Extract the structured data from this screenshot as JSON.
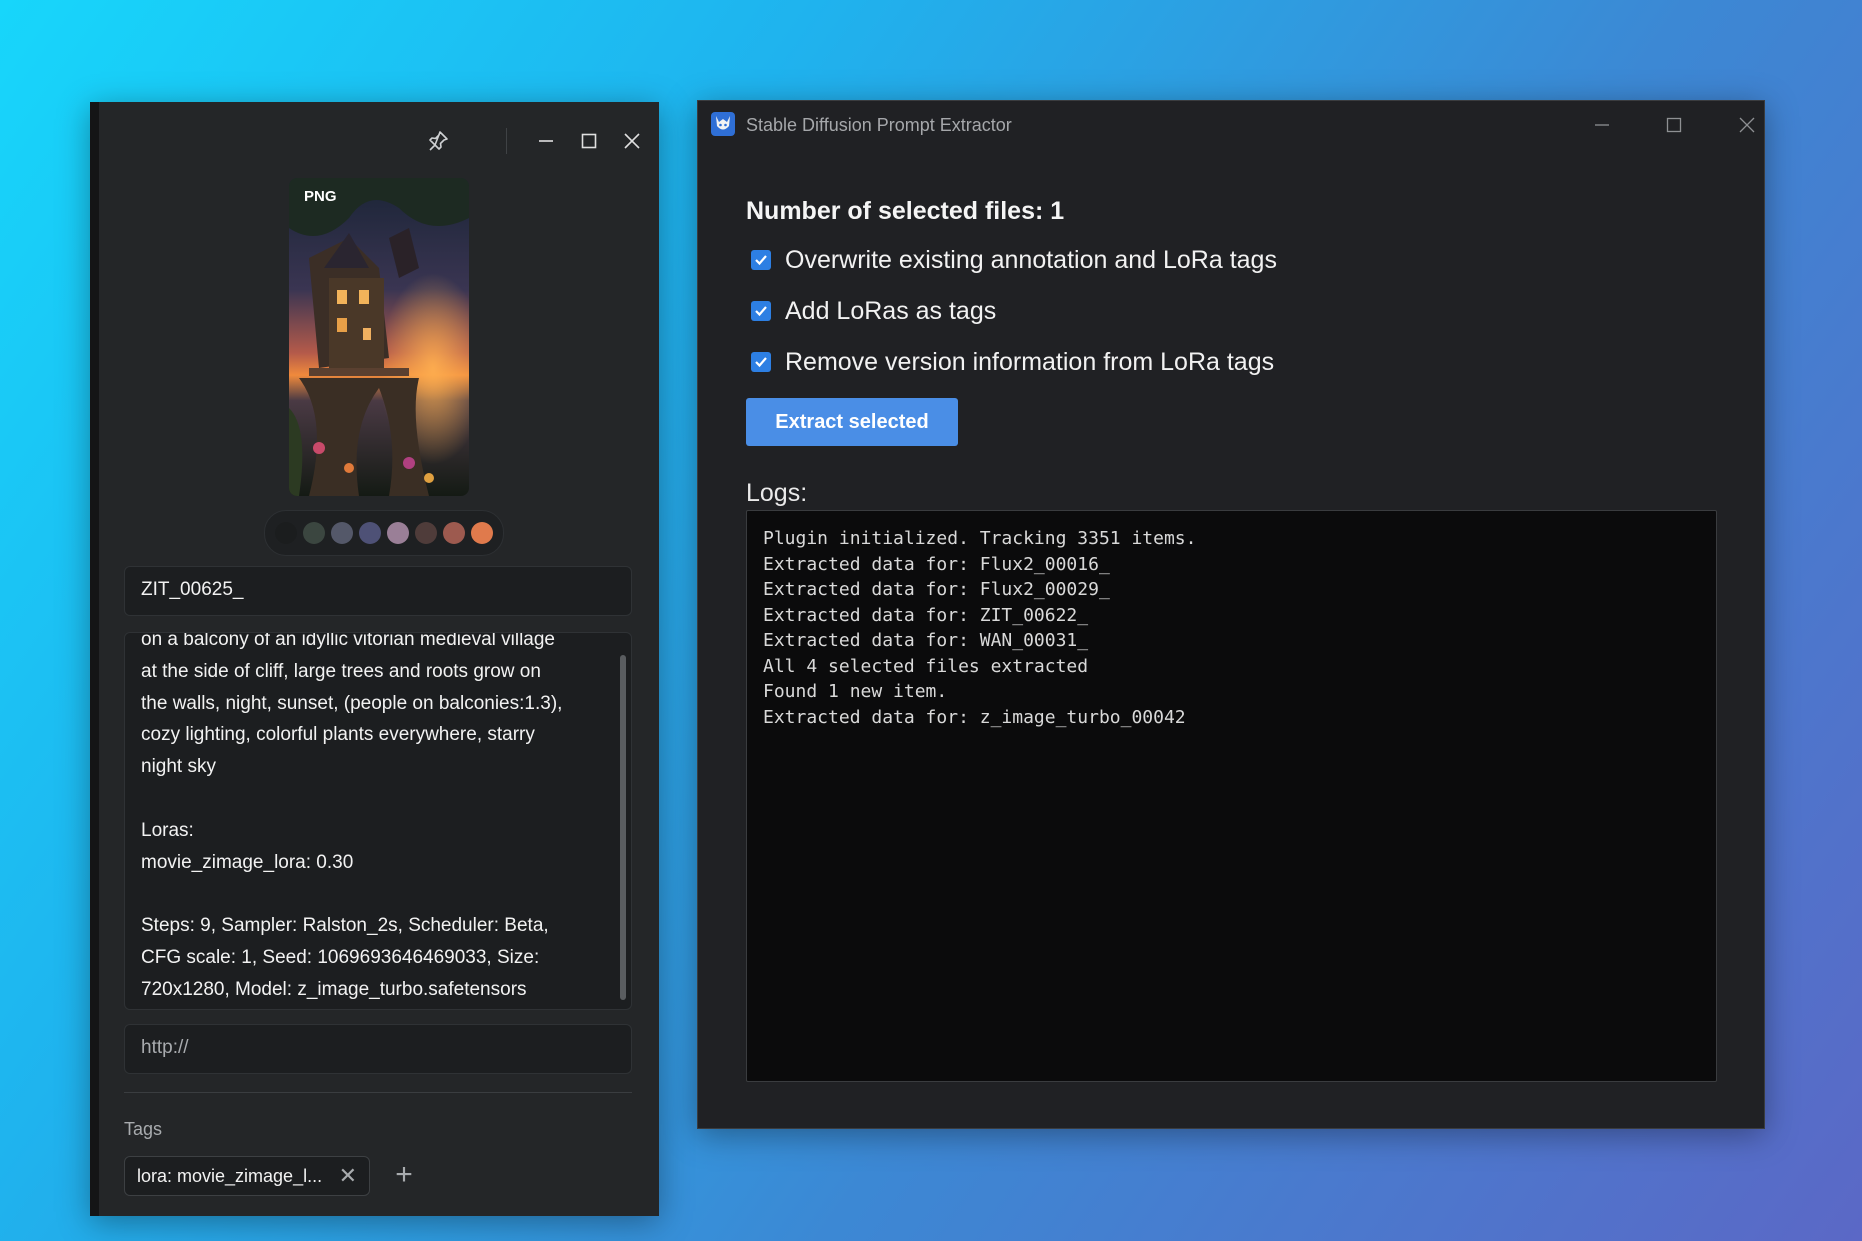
{
  "left_panel": {
    "thumbnail": {
      "badge": "PNG"
    },
    "palette": [
      "#1b1d1e",
      "#3b4640",
      "#545869",
      "#4e5176",
      "#9a7f97",
      "#4f3c3a",
      "#9d5a4f",
      "#e07a4c"
    ],
    "file_name": "ZIT_00625_",
    "annotation_lines": [
      "on a balcony of an idyllic vitorian medieval village",
      "at the side of cliff, large trees and roots grow on",
      "the walls, night, sunset, (people on balconies:1.3),",
      "cozy lighting, colorful plants everywhere, starry",
      "night sky",
      "",
      "Loras:",
      "movie_zimage_lora: 0.30",
      "",
      "Steps: 9, Sampler: Ralston_2s, Scheduler: Beta,",
      "CFG scale: 1, Seed: 1069693646469033, Size:",
      "720x1280, Model: z_image_turbo.safetensors"
    ],
    "url_placeholder": "http://",
    "tags_label": "Tags",
    "tags": [
      {
        "label": "lora: movie_zimage_l..."
      }
    ],
    "add_tag_symbol": "+"
  },
  "right_panel": {
    "title": "Stable Diffusion Prompt Extractor",
    "heading": "Number of selected files: 1",
    "options": [
      {
        "label": "Overwrite existing annotation and LoRa tags",
        "checked": true
      },
      {
        "label": "Add LoRas as tags",
        "checked": true
      },
      {
        "label": "Remove version information from LoRa tags",
        "checked": true
      }
    ],
    "extract_button": "Extract selected",
    "logs_label": "Logs:",
    "logs": [
      "Plugin initialized. Tracking 3351 items.",
      "Extracted data for: Flux2_00016_",
      "Extracted data for: Flux2_00029_",
      "Extracted data for: ZIT_00622_",
      "Extracted data for: WAN_00031_",
      "All 4 selected files extracted",
      "Found 1 new item.",
      "Extracted data for: z_image_turbo_00042"
    ]
  },
  "colors": {
    "accent_blue": "#4a8ee6",
    "checkbox_blue": "#2d7fe3",
    "window_bg": "#202124"
  }
}
